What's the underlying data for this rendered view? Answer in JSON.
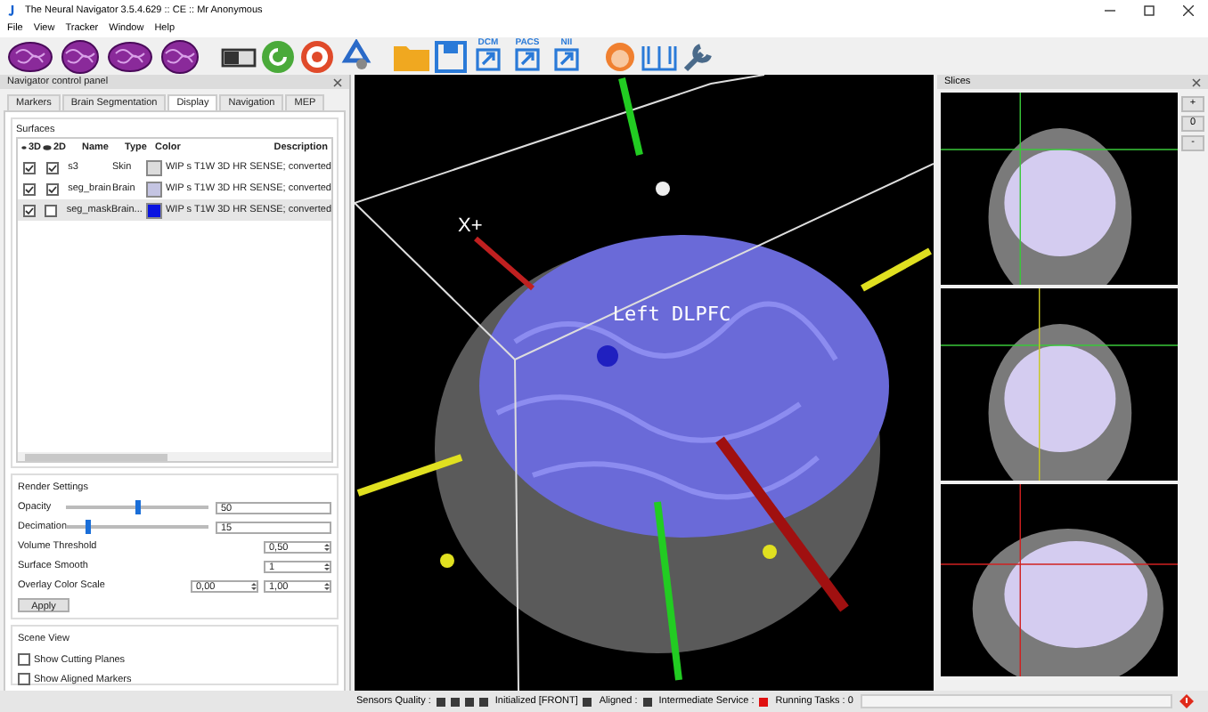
{
  "window": {
    "title": "The Neural Navigator 3.5.4.629 :: CE :: Mr Anonymous"
  },
  "menu": [
    "File",
    "View",
    "Tracker",
    "Window",
    "Help"
  ],
  "toolbar": {
    "import_labels": [
      "DCM",
      "PACS",
      "NII"
    ]
  },
  "control_panel": {
    "title": "Navigator control panel",
    "tabs": [
      {
        "label": "Markers",
        "selected": false
      },
      {
        "label": "Brain Segmentation",
        "selected": false
      },
      {
        "label": "Display",
        "selected": true
      },
      {
        "label": "Navigation",
        "selected": false
      },
      {
        "label": "MEP",
        "selected": false
      }
    ],
    "surfaces": {
      "title": "Surfaces",
      "columns": [
        "3D",
        "2D",
        "Name",
        "Type",
        "Color",
        "Description"
      ],
      "rows": [
        {
          "show_3d": true,
          "show_2d": true,
          "name": "s3",
          "type": "Skin",
          "color": "#dcdcdc",
          "description": "WIP s T1W 3D HR SENSE; converted",
          "selected": false
        },
        {
          "show_3d": true,
          "show_2d": true,
          "name": "seg_brain",
          "type": "Brain",
          "color": "#c4c4e2",
          "description": "WIP s T1W 3D HR SENSE; converted",
          "selected": false
        },
        {
          "show_3d": true,
          "show_2d": false,
          "name": "seg_mask",
          "type": "Brain...",
          "color": "#0a14e0",
          "description": "WIP s T1W 3D HR SENSE; converted",
          "selected": true
        }
      ]
    },
    "render_settings": {
      "title": "Render Settings",
      "sliders": [
        {
          "label": "Opacity",
          "level": 0.5,
          "value": "50"
        },
        {
          "label": "Decimation",
          "level": 0.15,
          "value": "15"
        }
      ],
      "spinners": [
        {
          "label": "Volume Threshold",
          "values": [
            "0,50"
          ]
        },
        {
          "label": "Surface Smooth",
          "values": [
            "1"
          ]
        },
        {
          "label": "Overlay Color Scale",
          "values": [
            "0,00",
            "1,00"
          ]
        }
      ],
      "apply": "Apply"
    },
    "scene_view": {
      "title": "Scene View",
      "options": [
        {
          "label": "Show Cutting Planes",
          "checked": false
        },
        {
          "label": "Show Aligned Markers",
          "checked": false
        }
      ]
    }
  },
  "view3d": {
    "axis_label": "X+",
    "target_label": "Left DLPFC"
  },
  "slices": {
    "title": "Slices",
    "buttons": [
      "+",
      "0",
      "-"
    ]
  },
  "status_bar": {
    "items": [
      {
        "label": "Sensors Quality :",
        "indicators": [
          {
            "color": "#3a3a3a"
          },
          {
            "color": "#3a3a3a"
          },
          {
            "color": "#3a3a3a"
          },
          {
            "color": "#3a3a3a"
          }
        ]
      },
      {
        "label": "Initialized [FRONT]",
        "indicators": [
          {
            "color": "#3a3a3a"
          }
        ]
      },
      {
        "label": "Aligned :",
        "indicators": [
          {
            "color": "#3a3a3a"
          }
        ]
      },
      {
        "label": "Intermediate Service :",
        "indicators": [
          {
            "color": "#e01010"
          }
        ]
      }
    ],
    "tasks": "Running Tasks : 0",
    "progress": {
      "level": 0
    }
  }
}
